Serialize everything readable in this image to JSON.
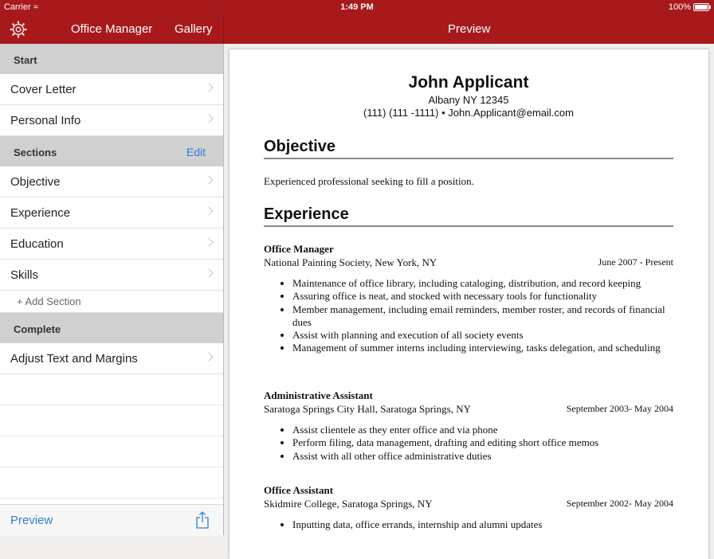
{
  "status": {
    "carrier": "Carrier",
    "time": "1:49 PM",
    "battery": "100%"
  },
  "nav": {
    "left_title": "Office Manager",
    "gallery": "Gallery",
    "right_title": "Preview"
  },
  "sidebar": {
    "start_header": "Start",
    "start_items": [
      {
        "label": "Cover Letter"
      },
      {
        "label": "Personal Info"
      }
    ],
    "sections_header": "Sections",
    "edit_label": "Edit",
    "section_items": [
      {
        "label": "Objective"
      },
      {
        "label": "Experience"
      },
      {
        "label": "Education"
      },
      {
        "label": "Skills"
      }
    ],
    "add_section": "+ Add Section",
    "complete_header": "Complete",
    "complete_items": [
      {
        "label": "Adjust Text and Margins"
      }
    ],
    "preview_label": "Preview"
  },
  "resume": {
    "name": "John Applicant",
    "address": "Albany NY 12345",
    "contact": "(111) (111 -1111) • John.Applicant@email.com",
    "objective_heading": "Objective",
    "objective_text": "Experienced professional seeking to fill a position.",
    "experience_heading": "Experience",
    "jobs": [
      {
        "title": "Office Manager",
        "org": "National Painting Society, New York, NY",
        "date": "June 2007 - Present",
        "bullets": [
          "Maintenance of office library, including cataloging, distribution, and record keeping",
          "Assuring office is neat, and stocked with necessary tools for functionality",
          "Member management, including email reminders, member roster, and records of financial dues",
          "Assist with planning and execution of all society events",
          "Management of summer interns including interviewing, tasks delegation, and scheduling"
        ]
      },
      {
        "title": "Administrative Assistant",
        "org": "Saratoga Springs City Hall, Saratoga Springs, NY",
        "date": "September 2003- May 2004",
        "bullets": [
          "Assist clientele as they enter office and via phone",
          "Perform filing, data management, drafting and editing short office memos",
          "Assist with all other office administrative duties"
        ]
      },
      {
        "title": "Office Assistant",
        "org": "Skidmire College, Saratoga Springs, NY",
        "date": "September 2002- May 2004",
        "bullets": [
          "Inputting data, office errands, internship and alumni updates"
        ]
      }
    ]
  }
}
